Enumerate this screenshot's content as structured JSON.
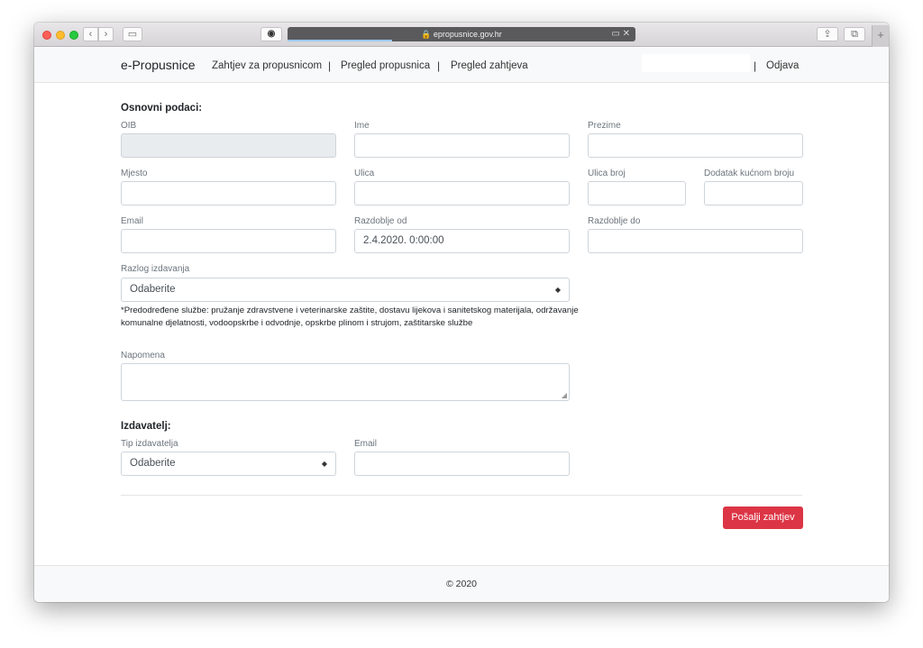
{
  "browser": {
    "url": "🔒 epropusnice.gov.hr",
    "back_glyph": "‹",
    "forward_glyph": "›",
    "sidebar_glyph": "▭",
    "ext_glyph": "◉",
    "share_glyph": "⇪",
    "tabs_glyph": "⧉",
    "newtab_glyph": "+",
    "addr_icons": "▭ ✕",
    "page_load_progress": 0.3
  },
  "nav": {
    "brand": "e-Propusnice",
    "links": [
      "Zahtjev za propusnicom",
      "Pregled propusnica",
      "Pregled zahtjeva"
    ],
    "separator": "|",
    "logout": "Odjava"
  },
  "form": {
    "basic_title": "Osnovni podaci:",
    "fields": {
      "oib": {
        "label": "OIB",
        "value": ""
      },
      "ime": {
        "label": "Ime",
        "value": ""
      },
      "prezime": {
        "label": "Prezime",
        "value": ""
      },
      "mjesto": {
        "label": "Mjesto",
        "value": ""
      },
      "ulica": {
        "label": "Ulica",
        "value": ""
      },
      "ulica_broj": {
        "label": "Ulica broj",
        "value": ""
      },
      "dodatak": {
        "label": "Dodatak kućnom broju",
        "value": ""
      },
      "email": {
        "label": "Email",
        "value": ""
      },
      "razdoblje_od": {
        "label": "Razdoblje od",
        "value": "2.4.2020. 0:00:00"
      },
      "razdoblje_do": {
        "label": "Razdoblje do",
        "value": ""
      },
      "razlog": {
        "label": "Razlog izdavanja",
        "value": "Odaberite"
      }
    },
    "note": "*Predodređene službe: pružanje zdravstvene i veterinarske zaštite, dostavu lijekova i sanitetskog materijala, održavanje komunalne djelatnosti, vodoopskrbe i odvodnje, opskrbe plinom i strujom, zaštitarske službe",
    "napomena_label": "Napomena",
    "issuer_title": "Izdavatelj:",
    "issuer": {
      "tip_label": "Tip izdavatelja",
      "tip_value": "Odaberite",
      "email_label": "Email",
      "email_value": ""
    },
    "select_arrow": "◆",
    "submit": "Pošalji zahtjev"
  },
  "footer": {
    "text": "© 2020"
  }
}
